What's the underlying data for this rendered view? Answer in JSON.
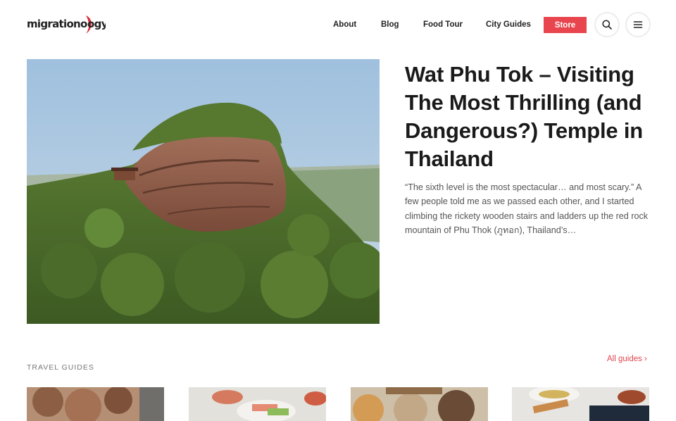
{
  "header": {
    "logo": "migrationology",
    "nav": [
      {
        "label": "About"
      },
      {
        "label": "Blog"
      },
      {
        "label": "Food Tour"
      },
      {
        "label": "City Guides"
      }
    ],
    "store_label": "Store",
    "search_icon": "search-icon",
    "menu_icon": "hamburger-menu-icon"
  },
  "hero": {
    "image": "photo of Wat Phu Tok red rock mountain covered in forest",
    "title": "Wat Phu Tok – Visiting The Most Thrilling (and Dangerous?) Temple in Thailand",
    "excerpt": "“The sixth level is the most spectacular… and most scary.” A few people told me as we passed each other, and I started climbing the rickety wooden stairs and ladders up the red rock mountain of Phu Thok (ภูทอก), Thailand’s…"
  },
  "guides": {
    "label": "TRAVEL GUIDES",
    "all_link": "All guides ›",
    "cards": [
      {
        "image": "food photo"
      },
      {
        "image": "food photo"
      },
      {
        "image": "food photo"
      },
      {
        "image": "food photo"
      }
    ]
  },
  "colors": {
    "accent": "#e8454e",
    "text": "#1a1a1a",
    "muted": "#555555"
  }
}
